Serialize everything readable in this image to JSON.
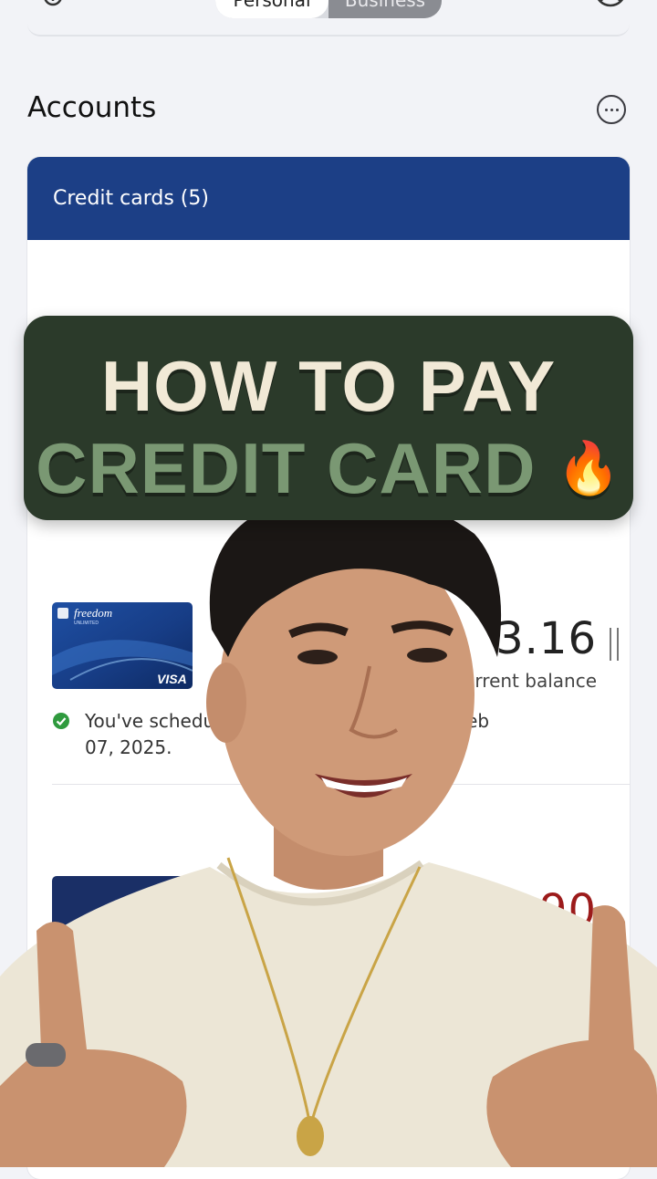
{
  "topbar": {
    "segments": [
      "Personal",
      "Business"
    ],
    "selected": "Personal",
    "add_account_icon": "add-account-icon",
    "profile_icon": "profile-icon"
  },
  "accounts": {
    "title": "Accounts",
    "more_icon": "more-options-icon"
  },
  "credit_cards": {
    "header": "Credit cards (5)",
    "cards": [
      {
        "card_brand": "freedom",
        "card_sub": "UNLIMITED",
        "network": "VISA",
        "balance": "3.16",
        "balance_label": "rrent balance",
        "scheduled_prefix": "You've schedul",
        "scheduled_suffix": "for Feb",
        "scheduled_line2": "07, 2025."
      },
      {
        "balance": "2.90"
      }
    ]
  },
  "overlay": {
    "line1": "HOW TO PAY",
    "line2": "CREDIT CARD",
    "emoji": "🔥"
  },
  "colors": {
    "header_blue": "#1c3f86",
    "banner_green": "#2b3a2a",
    "title_cream": "#f1e9d6",
    "title_sage": "#7a9873",
    "balance_red": "#9c1b1b",
    "check_green": "#2f9a3e"
  }
}
